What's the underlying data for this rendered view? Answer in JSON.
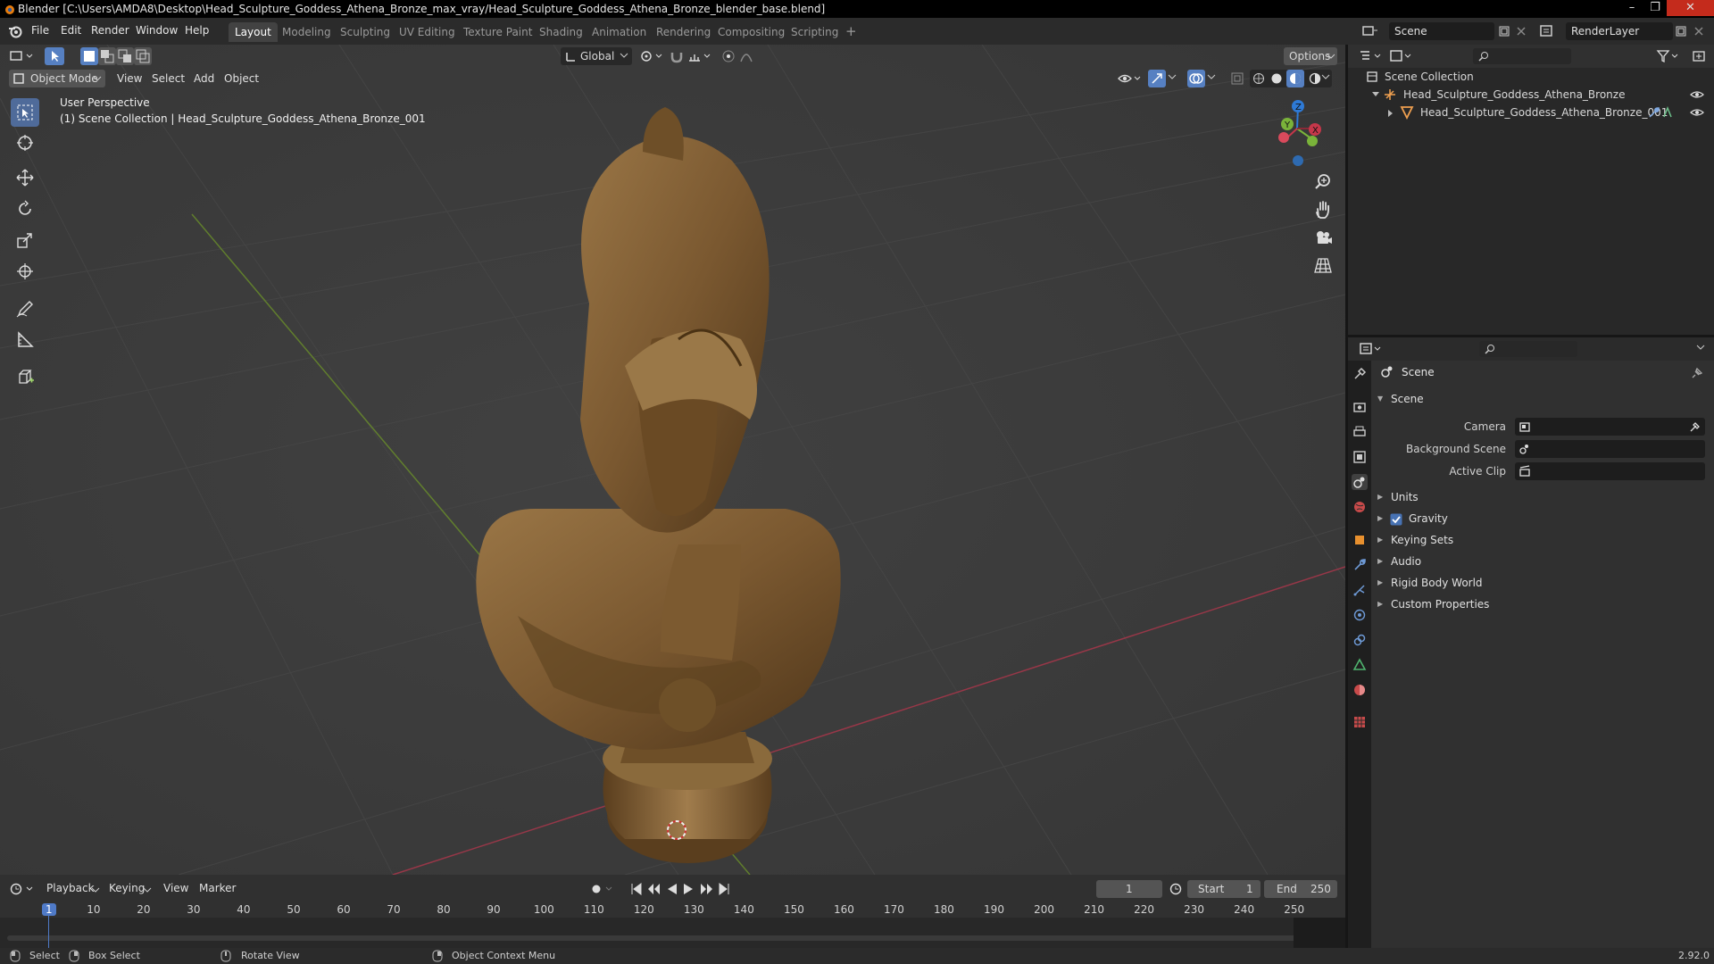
{
  "window": {
    "title": "Blender [C:\\Users\\AMDA8\\Desktop\\Head_Sculpture_Goddess_Athena_Bronze_max_vray/Head_Sculpture_Goddess_Athena_Bronze_blender_base.blend]",
    "minimize": "–",
    "maximize": "❐",
    "close": "✕"
  },
  "menu": {
    "items": [
      "File",
      "Edit",
      "Render",
      "Window",
      "Help"
    ],
    "workspaces": [
      "Layout",
      "Modeling",
      "Sculpting",
      "UV Editing",
      "Texture Paint",
      "Shading",
      "Animation",
      "Rendering",
      "Compositing",
      "Scripting"
    ],
    "active_workspace": "Layout",
    "add_workspace": "+",
    "scene": "Scene",
    "render_layer": "RenderLayer"
  },
  "viewport": {
    "mode": "Object Mode",
    "menus": [
      "View",
      "Select",
      "Add",
      "Object"
    ],
    "transform_orientation": "Global",
    "options": "Options",
    "perspective_label": "User Perspective",
    "collection_label": "(1) Scene Collection | Head_Sculpture_Goddess_Athena_Bronze_001",
    "gizmo": {
      "x": "X",
      "y": "Y",
      "z": "Z"
    },
    "colors": {
      "background": "#3d3d3d",
      "grid": "#454545",
      "x_axis": "#a2374a",
      "y_axis": "#6a8f2a",
      "active_tool": "#4f6b9a",
      "bronze": "#8a6638"
    }
  },
  "outliner": {
    "root": "Scene Collection",
    "collection": "Head_Sculpture_Goddess_Athena_Bronze",
    "object": "Head_Sculpture_Goddess_Athena_Bronze_001"
  },
  "properties": {
    "context": "Scene",
    "section": "Scene",
    "fields": [
      {
        "label": "Camera",
        "value": ""
      },
      {
        "label": "Background Scene",
        "value": ""
      },
      {
        "label": "Active Clip",
        "value": ""
      }
    ],
    "panels": [
      {
        "label": "Units",
        "checkbox": false
      },
      {
        "label": "Gravity",
        "checkbox": true
      },
      {
        "label": "Keying Sets",
        "checkbox": false
      },
      {
        "label": "Audio",
        "checkbox": false
      },
      {
        "label": "Rigid Body World",
        "checkbox": false
      },
      {
        "label": "Custom Properties",
        "checkbox": false
      }
    ]
  },
  "timeline": {
    "menus": [
      "Playback",
      "Keying",
      "View",
      "Marker"
    ],
    "current_frame": "1",
    "start_label": "Start",
    "start": "1",
    "end_label": "End",
    "end": "250",
    "ruler": [
      "1",
      "10",
      "20",
      "30",
      "40",
      "50",
      "60",
      "70",
      "80",
      "90",
      "100",
      "110",
      "120",
      "130",
      "140",
      "150",
      "160",
      "170",
      "180",
      "190",
      "200",
      "210",
      "220",
      "230",
      "240",
      "250"
    ]
  },
  "status": {
    "select": "Select",
    "box_select": "Box Select",
    "rotate_view": "Rotate View",
    "context_menu": "Object Context Menu",
    "version": "2.92.0"
  }
}
